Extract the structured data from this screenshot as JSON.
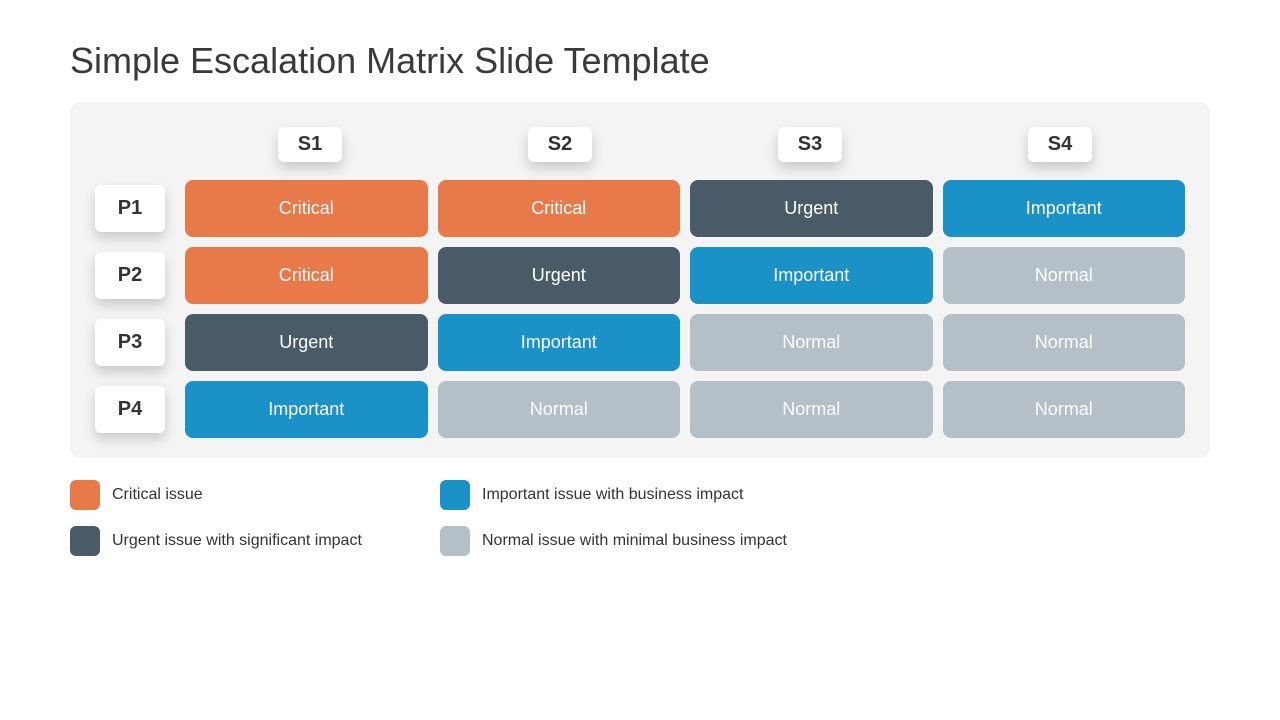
{
  "title": "Simple Escalation Matrix Slide Template",
  "columns": [
    "S1",
    "S2",
    "S3",
    "S4"
  ],
  "rows": [
    "P1",
    "P2",
    "P3",
    "P4"
  ],
  "colors": {
    "critical": "#e87a4a",
    "urgent": "#4a5b68",
    "important": "#1a91c7",
    "normal": "#b4bfc7"
  },
  "labels": {
    "critical": "Critical",
    "urgent": "Urgent",
    "important": "Important",
    "normal": "Normal"
  },
  "matrix": [
    [
      "critical",
      "critical",
      "urgent",
      "important"
    ],
    [
      "critical",
      "urgent",
      "important",
      "normal"
    ],
    [
      "urgent",
      "important",
      "normal",
      "normal"
    ],
    [
      "important",
      "normal",
      "normal",
      "normal"
    ]
  ],
  "legend": [
    {
      "key": "critical",
      "text": "Critical issue"
    },
    {
      "key": "important",
      "text": "Important issue with business impact"
    },
    {
      "key": "urgent",
      "text": "Urgent issue with significant impact"
    },
    {
      "key": "normal",
      "text": "Normal issue with minimal business impact"
    }
  ]
}
